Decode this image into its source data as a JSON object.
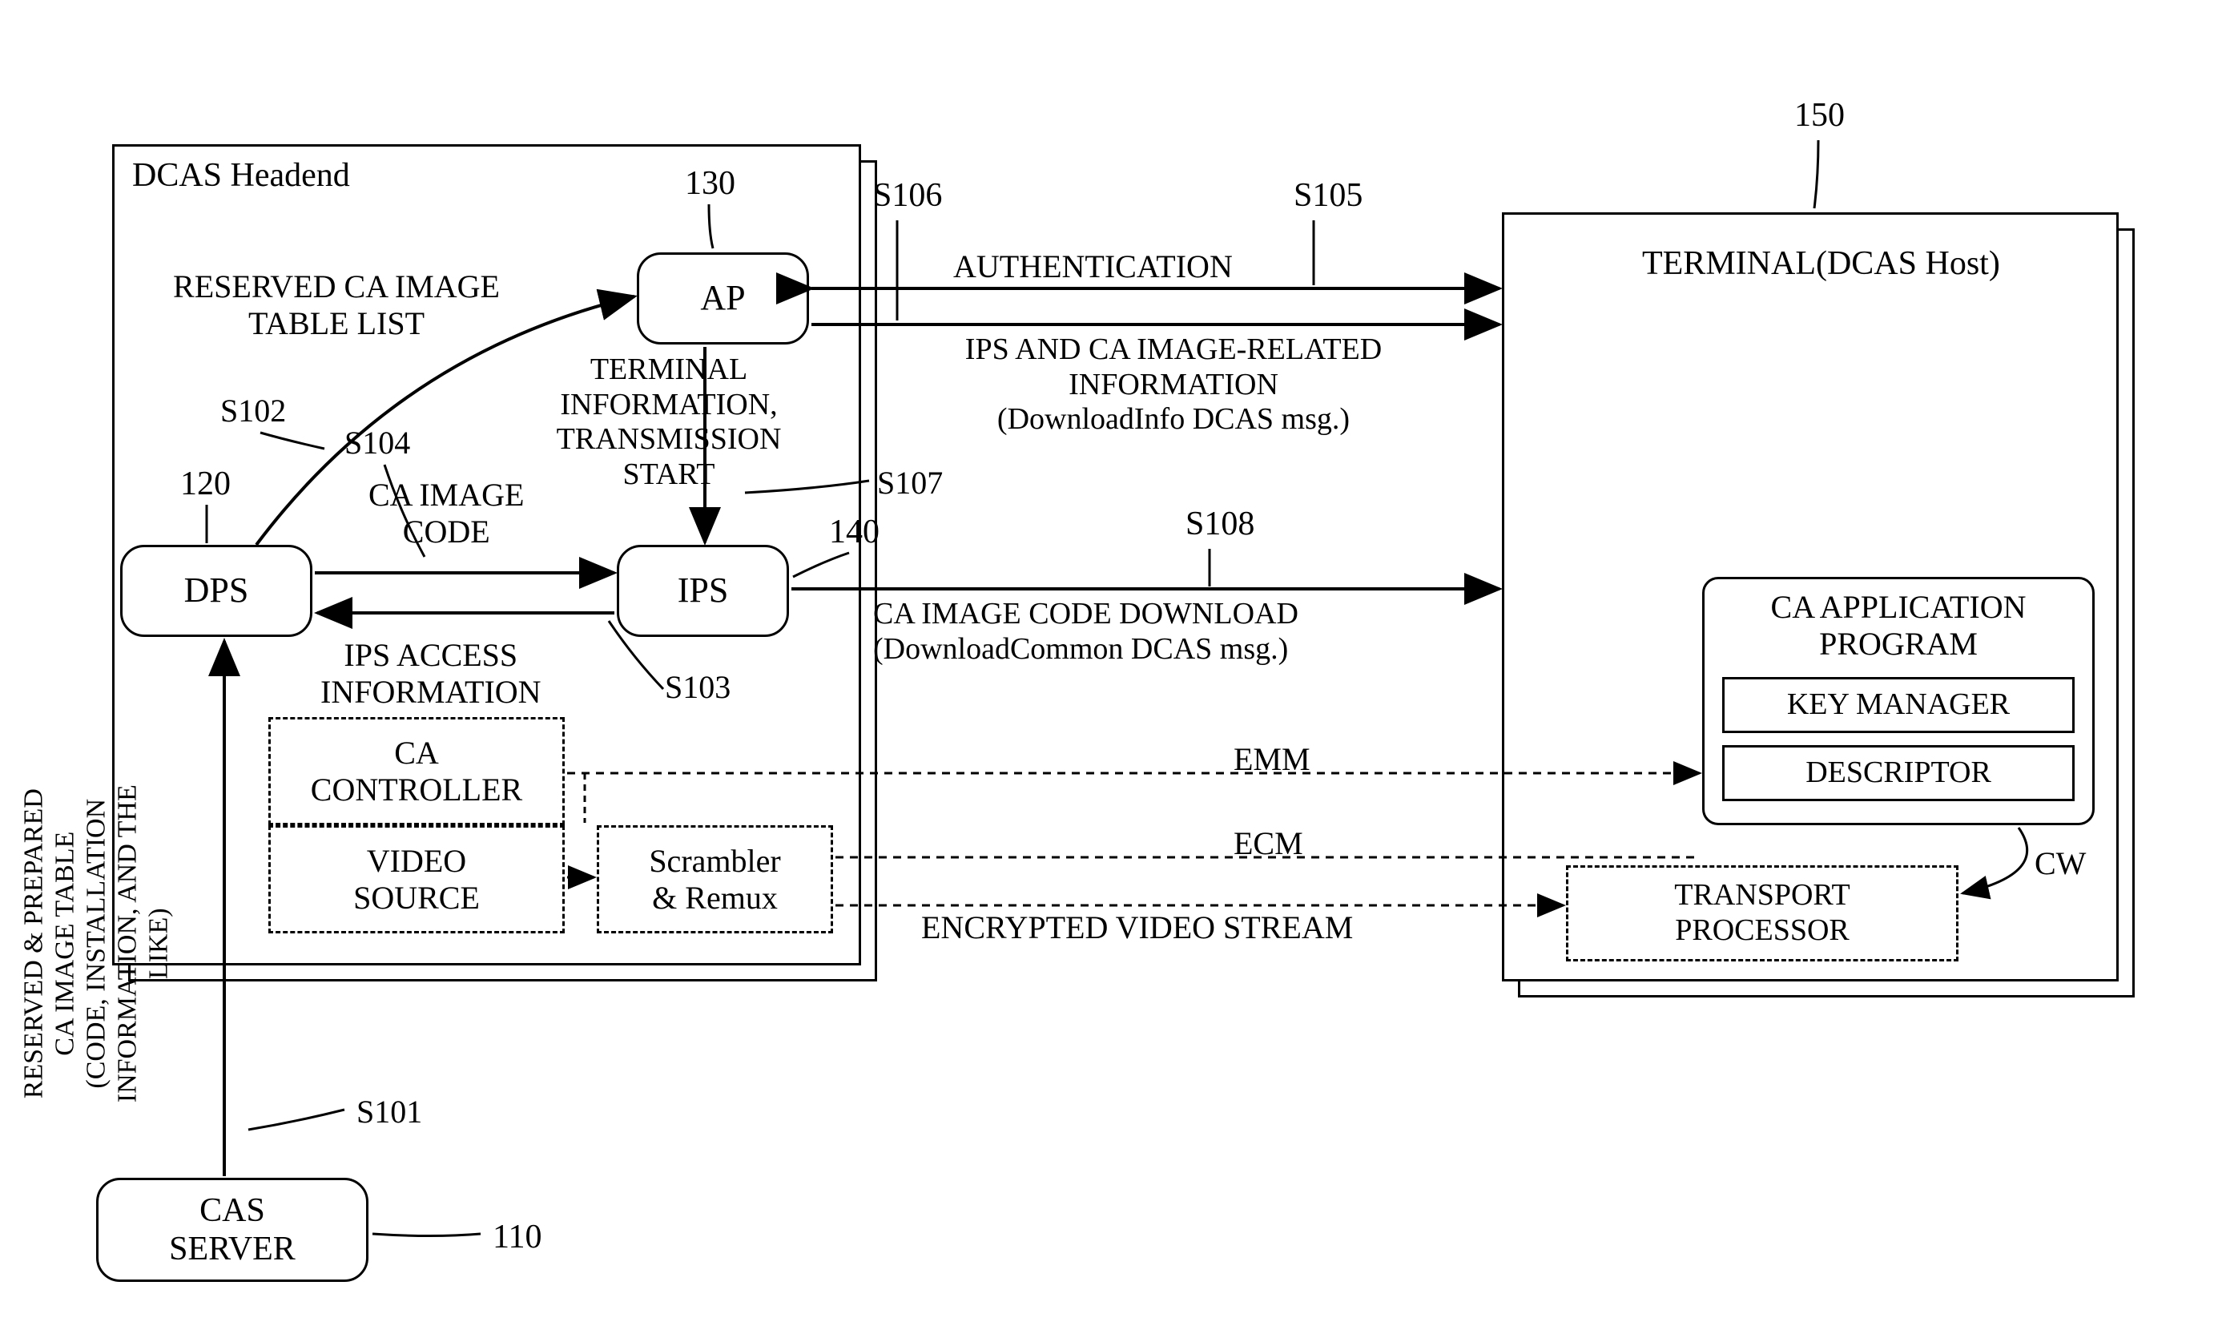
{
  "headend": {
    "title": "DCAS Headend",
    "dps": {
      "label": "DPS",
      "ref": "120"
    },
    "ap": {
      "label": "AP",
      "ref": "130"
    },
    "ips": {
      "label": "IPS",
      "ref": "140"
    },
    "ca_controller": "CA\nCONTROLLER",
    "video_source": "VIDEO\nSOURCE",
    "scrambler": "Scrambler\n& Remux"
  },
  "terminal": {
    "title": "TERMINAL(DCAS Host)",
    "ref": "150",
    "ca_app": "CA APPLICATION\nPROGRAM",
    "key_mgr": "KEY MANAGER",
    "descriptor": "DESCRIPTOR",
    "cw": "CW",
    "transport": "TRANSPORT\nPROCESSOR"
  },
  "cas": {
    "label": "CAS\nSERVER",
    "ref": "110"
  },
  "flows": {
    "s101": "S101",
    "s101_text": "RESERVED & PREPARED\nCA IMAGE TABLE\n(CODE, INSTALLATION\nINFORMATION, AND THE\nLIKE)",
    "s102": "S102",
    "s102_text": "RESERVED CA IMAGE\nTABLE LIST",
    "s103": "S103",
    "s103_text": "IPS ACCESS\nINFORMATION",
    "s104": "S104",
    "s104_text": "CA IMAGE\nCODE",
    "s105": "S105",
    "s105_text": "AUTHENTICATION",
    "s106": "S106",
    "s106_text": "IPS AND CA IMAGE-RELATED\nINFORMATION\n(DownloadInfo DCAS msg.)",
    "s107": "S107",
    "s107_text": "TERMINAL\nINFORMATION,\nTRANSMISSION\nSTART",
    "s108": "S108",
    "s108_text": "CA IMAGE CODE DOWNLOAD\n(DownloadCommon DCAS msg.)",
    "emm": "EMM",
    "ecm": "ECM",
    "video": "ENCRYPTED VIDEO STREAM"
  }
}
